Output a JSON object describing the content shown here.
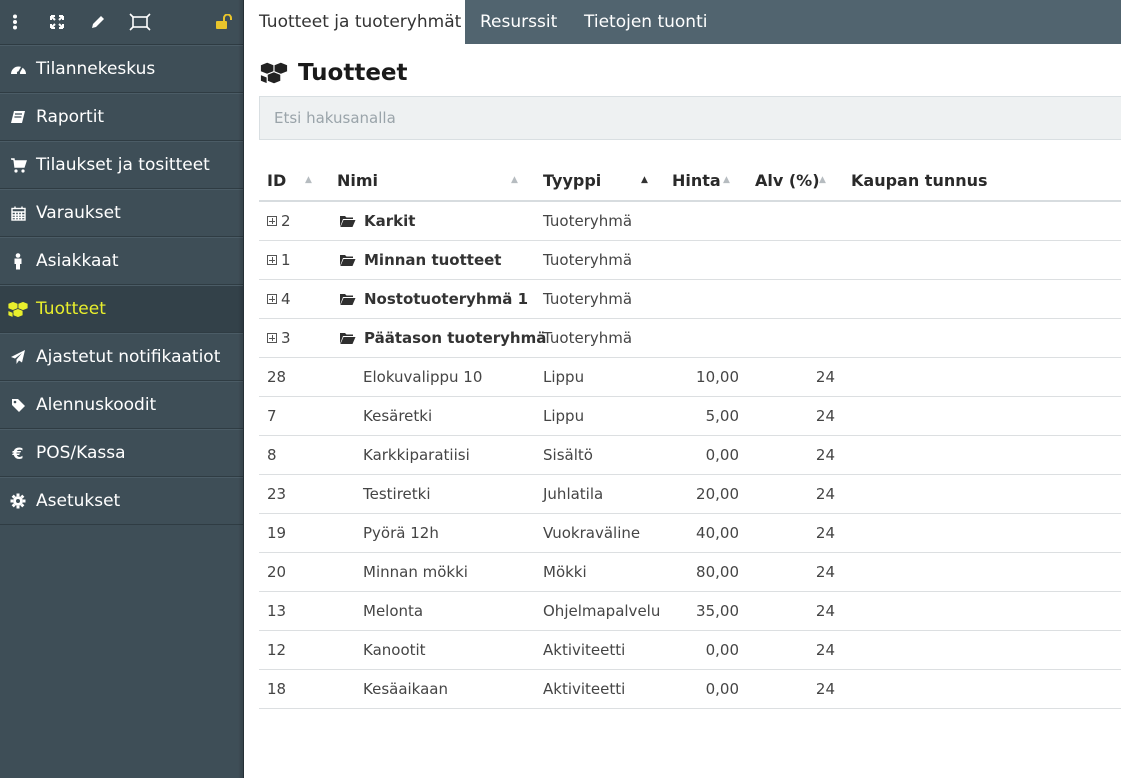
{
  "topbar": {
    "icons": [
      "vertical-dots-icon",
      "expand-icon",
      "pencil-icon",
      "resize-icon",
      "unlock-icon"
    ]
  },
  "sidebar": {
    "items": [
      {
        "label": "Tilannekeskus",
        "icon": "dashboard-icon",
        "active": false
      },
      {
        "label": "Raportit",
        "icon": "book-icon",
        "active": false
      },
      {
        "label": "Tilaukset ja tositteet",
        "icon": "cart-icon",
        "active": false
      },
      {
        "label": "Varaukset",
        "icon": "calendar-icon",
        "active": false
      },
      {
        "label": "Asiakkaat",
        "icon": "person-icon",
        "active": false
      },
      {
        "label": "Tuotteet",
        "icon": "cubes-icon",
        "active": true
      },
      {
        "label": "Ajastetut notifikaatiot",
        "icon": "paper-plane-icon",
        "active": false
      },
      {
        "label": "Alennuskoodit",
        "icon": "tag-icon",
        "active": false
      },
      {
        "label": "POS/Kassa",
        "icon": "euro-icon",
        "active": false
      },
      {
        "label": "Asetukset",
        "icon": "gear-icon",
        "active": false
      }
    ],
    "active_color": "#e9ef2c"
  },
  "tabs": [
    {
      "label": "Tuotteet ja tuoteryhmät",
      "active": true
    },
    {
      "label": "Resurssit",
      "active": false
    },
    {
      "label": "Tietojen tuonti",
      "active": false
    }
  ],
  "page": {
    "title": "Tuotteet",
    "search_placeholder": "Etsi hakusanalla"
  },
  "table": {
    "columns": [
      {
        "label": "ID",
        "sorted": false
      },
      {
        "label": "Nimi",
        "sorted": false
      },
      {
        "label": "Tyyppi",
        "sorted": true
      },
      {
        "label": "Hinta",
        "sorted": false
      },
      {
        "label": "Alv (%)",
        "sorted": false
      },
      {
        "label": "Kaupan tunnus",
        "sorted": false
      }
    ],
    "groups": [
      {
        "id": "2",
        "name": "Karkit",
        "type": "Tuoteryhmä"
      },
      {
        "id": "1",
        "name": "Minnan tuotteet",
        "type": "Tuoteryhmä"
      },
      {
        "id": "4",
        "name": "Nostotuoteryhmä 1",
        "type": "Tuoteryhmä"
      },
      {
        "id": "3",
        "name": "Päätason tuoteryhmä",
        "type": "Tuoteryhmä"
      }
    ],
    "products": [
      {
        "id": "28",
        "name": "Elokuvalippu 10",
        "type": "Lippu",
        "price": "10,00",
        "vat": "24"
      },
      {
        "id": "7",
        "name": "Kesäretki",
        "type": "Lippu",
        "price": "5,00",
        "vat": "24"
      },
      {
        "id": "8",
        "name": "Karkkiparatiisi",
        "type": "Sisältö",
        "price": "0,00",
        "vat": "24"
      },
      {
        "id": "23",
        "name": "Testiretki",
        "type": "Juhlatila",
        "price": "20,00",
        "vat": "24"
      },
      {
        "id": "19",
        "name": "Pyörä 12h",
        "type": "Vuokraväline",
        "price": "40,00",
        "vat": "24"
      },
      {
        "id": "20",
        "name": "Minnan mökki",
        "type": "Mökki",
        "price": "80,00",
        "vat": "24"
      },
      {
        "id": "13",
        "name": "Melonta",
        "type": "Ohjelmapalvelu",
        "price": "35,00",
        "vat": "24"
      },
      {
        "id": "12",
        "name": "Kanootit",
        "type": "Aktiviteetti",
        "price": "0,00",
        "vat": "24"
      },
      {
        "id": "18",
        "name": "Kesäaikaan",
        "type": "Aktiviteetti",
        "price": "0,00",
        "vat": "24"
      }
    ]
  }
}
